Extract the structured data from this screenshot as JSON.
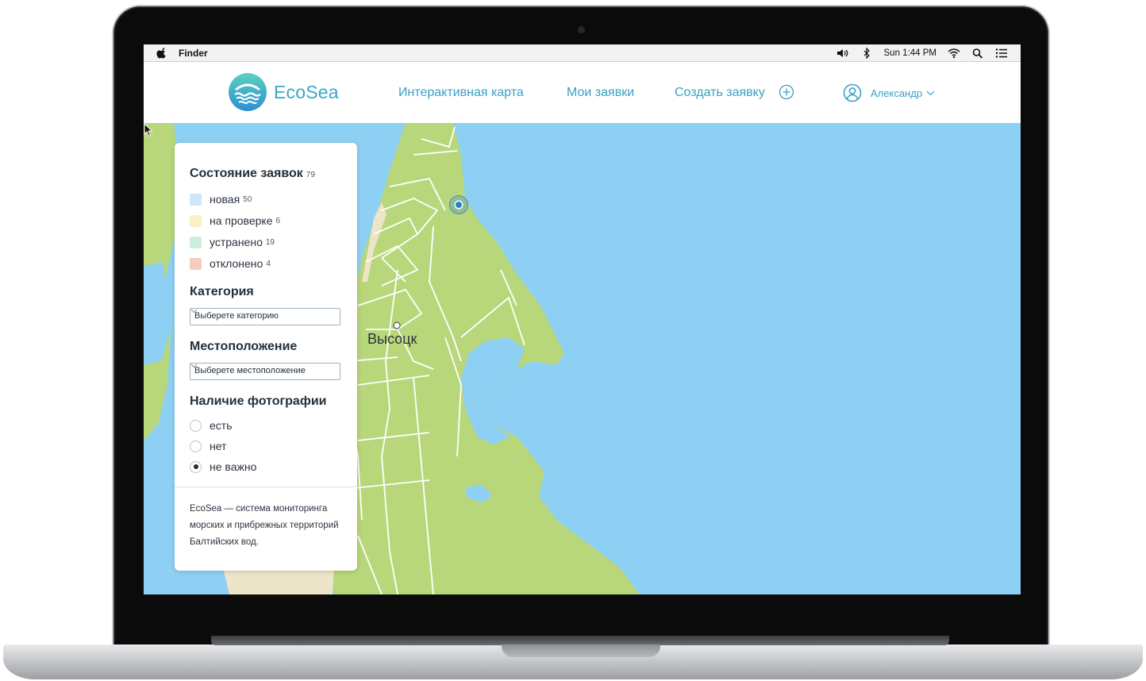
{
  "menubar": {
    "app_name": "Finder",
    "clock": "Sun 1:44 PM"
  },
  "header": {
    "brand": "EcoSea",
    "nav": {
      "map": "Интерактивная карта",
      "my_requests": "Мои заявки",
      "create": "Создать заявку"
    },
    "user_name": "Александр"
  },
  "map": {
    "city_label": "Высоцк"
  },
  "filters": {
    "status": {
      "title": "Состояние заявок",
      "total": "79",
      "items": [
        {
          "label": "новая",
          "count": "50",
          "color": "#cfe7f8"
        },
        {
          "label": "на проверке",
          "count": "6",
          "color": "#fbf0c2"
        },
        {
          "label": "устранено",
          "count": "19",
          "color": "#cdeedd"
        },
        {
          "label": "отклонено",
          "count": "4",
          "color": "#f5cdc0"
        }
      ]
    },
    "category": {
      "title": "Категория",
      "placeholder": "Выберете категорию"
    },
    "location": {
      "title": "Местоположение",
      "placeholder": "Выберете местоположение"
    },
    "photo": {
      "title": "Наличие фотографии",
      "options": [
        "есть",
        "нет",
        "не важно"
      ],
      "selected": "не важно"
    },
    "description": "EcoSea — система мониторинга морских и прибрежных территорий Балтийских вод."
  },
  "colors": {
    "accent": "#3aa6c9",
    "sea": "#8ed0f3",
    "land": "#b7d77a"
  }
}
